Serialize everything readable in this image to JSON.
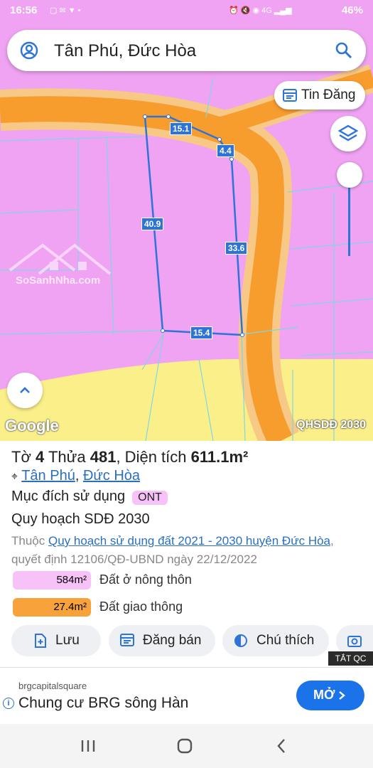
{
  "status_bar": {
    "time": "16:56",
    "battery": "46%"
  },
  "search": {
    "value": "Tân Phú, Đức Hòa"
  },
  "tin_dang": {
    "label": "Tin Đăng"
  },
  "map": {
    "dimensions": [
      "15.1",
      "4.4",
      "40.9",
      "33.6",
      "15.4"
    ],
    "watermark": "SoSanhNha.com",
    "google_label": "Google",
    "layer_label": "QHSDĐ 2030"
  },
  "parcel": {
    "sheet_prefix": "Tờ",
    "sheet_number": "4",
    "lot_prefix": "Thửa",
    "lot_number": "481",
    "area_prefix": ", Diện tích",
    "area_value": "611.1m²",
    "ward": "Tân Phú",
    "district": "Đức Hòa",
    "purpose_label": "Mục đích sử dụng",
    "purpose_code": "ONT",
    "plan_title": "Quy hoạch SDĐ 2030",
    "belong_prefix": "Thuộc",
    "plan_link": "Quy hoạch sử dụng đất 2021 - 2030 huyện Đức Hòa",
    "decision_text": "quyết định 12106/QĐ-UBND ngày 22/12/2022",
    "legend": [
      {
        "area": "584m²",
        "name": "Đất ở nông thôn",
        "color": "#f6c2f7"
      },
      {
        "area": "27.4m²",
        "name": "Đất giao thông",
        "color": "#f7a23a"
      }
    ]
  },
  "actions": {
    "save": "Lưu",
    "post_sale": "Đăng bán",
    "legend_note": "Chú thích"
  },
  "ad": {
    "badge": "TẮT QC",
    "source": "brgcapitalsquare",
    "headline": "Chung cư BRG sông Hàn",
    "cta": "MỞ"
  },
  "colors": {
    "accent": "#2d74d8",
    "residential": "#f0a3f3",
    "road": "#f7a23a",
    "agri": "#fbef8a"
  }
}
